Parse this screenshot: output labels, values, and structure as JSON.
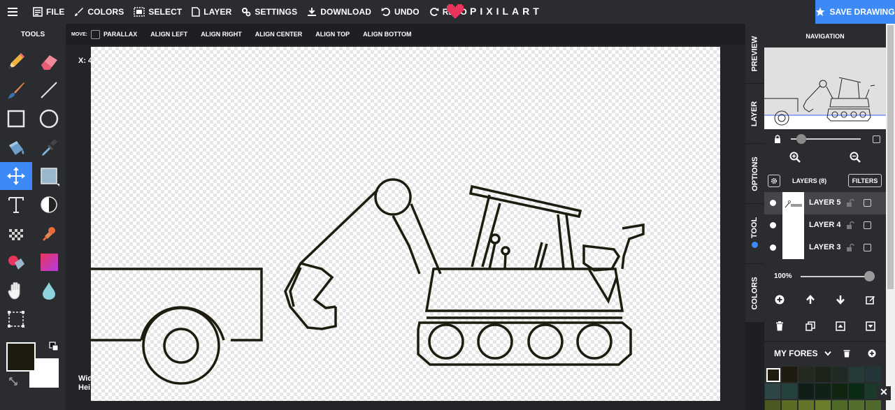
{
  "topbar": {
    "menu": [
      {
        "label": "FILE",
        "icon": "file-icon"
      },
      {
        "label": "COLORS",
        "icon": "brush-icon"
      },
      {
        "label": "SELECT",
        "icon": "select-icon"
      },
      {
        "label": "LAYER",
        "icon": "layer-icon"
      },
      {
        "label": "SETTINGS",
        "icon": "settings-icon"
      },
      {
        "label": "DOWNLOAD",
        "icon": "download-icon"
      },
      {
        "label": "UNDO",
        "icon": "undo-icon"
      },
      {
        "label": "REDO",
        "icon": "redo-icon"
      }
    ],
    "logo": "PIXILART",
    "logo_color": "#e8355d",
    "save_label": "SAVE DRAWING"
  },
  "tools": {
    "title": "TOOLS",
    "primary_color": "#1d1c0f",
    "secondary_color": "#ffffff",
    "active_tool": "move-tool",
    "items": [
      "pencil-tool",
      "eraser-tool",
      "brush-tool",
      "line-tool",
      "rectangle-tool",
      "circle-tool",
      "bucket-tool",
      "eyedropper-tool",
      "move-tool",
      "shade-tool",
      "text-tool",
      "lighten-tool",
      "dither-tool",
      "stamp-tool",
      "mirror-eraser-tool",
      "gradient-tool",
      "hand-tool",
      "blur-tool",
      "selection-tool"
    ]
  },
  "options": {
    "move_label": "MOVE:",
    "parallax": "PARALLAX",
    "buttons": [
      "ALIGN LEFT",
      "ALIGN RIGHT",
      "ALIGN CENTER",
      "ALIGN TOP",
      "ALIGN BOTTOM"
    ]
  },
  "canvas": {
    "coord_x": "X: 4",
    "width_label": "Wid",
    "height_label": "Hei"
  },
  "side_tabs": [
    "PREVIEW",
    "LAYER",
    "OPTIONS",
    "TOOL",
    "COLORS"
  ],
  "panel": {
    "nav_title": "NAVIGATION",
    "layers_title": "LAYERS (8)",
    "filters": "FILTERS",
    "layers": [
      {
        "name": "LAYER 5",
        "selected": true
      },
      {
        "name": "LAYER 4",
        "selected": false
      },
      {
        "name": "LAYER 3",
        "selected": false
      }
    ],
    "opacity": "100%",
    "palette_name": "MY FORES",
    "palette": [
      "#ffffff",
      "#1d1c0f",
      "#242a20",
      "#1c2319",
      "#1f2a25",
      "#243b37",
      "#23363a",
      "#2f4647",
      "#24423b",
      "#0d1f17",
      "#102116",
      "#0f2510",
      "#0a2a13",
      "#1c3a2a",
      "#4c5a22",
      "#5b6b22",
      "#64752a",
      "#6a7e2c",
      "#4f6a27",
      "#526f2e",
      "#4f6a2a"
    ]
  }
}
